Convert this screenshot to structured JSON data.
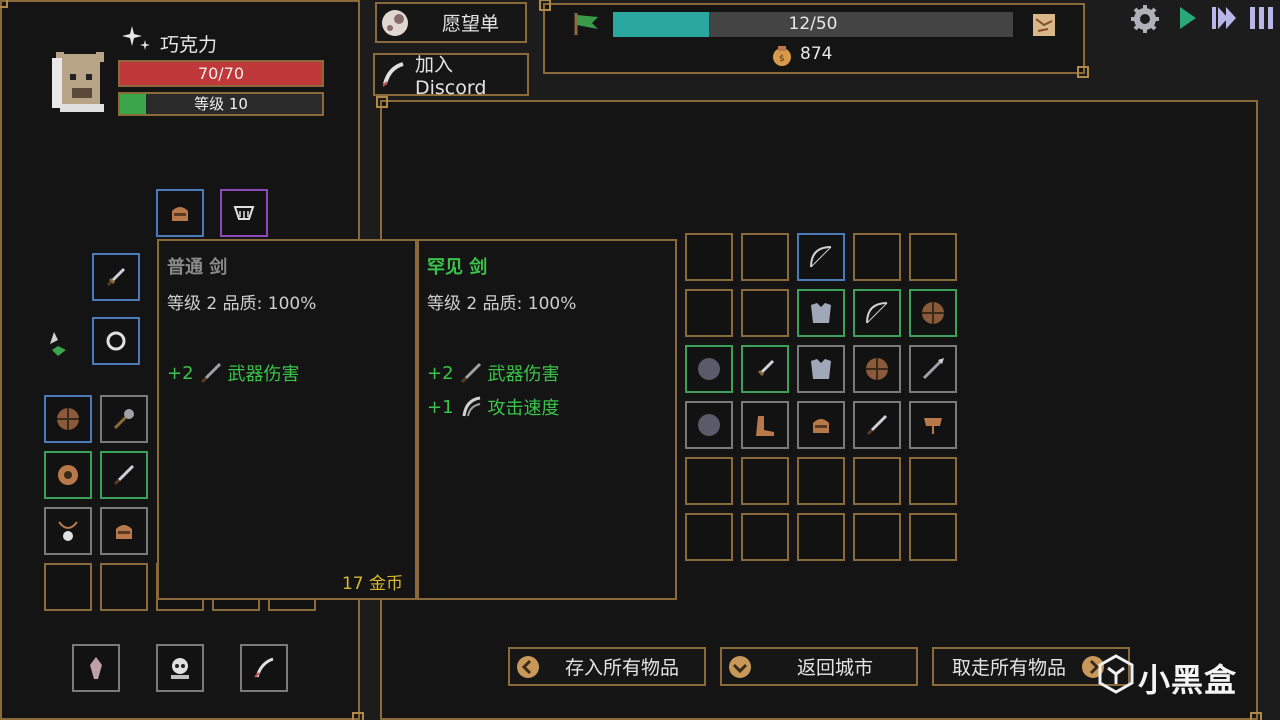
{
  "character": {
    "name": "巧克力",
    "hp_text": "70/70",
    "hp_fraction": 1.0,
    "level_text": "等级 10",
    "xp_fraction": 0.13
  },
  "top": {
    "wishlist_label": "愿望单",
    "discord_label": "加入 Discord",
    "progress_text": "12/50",
    "progress_fraction": 0.24,
    "gold": "874"
  },
  "controls": {
    "settings_icon": "gear-icon",
    "play_icon": "play-icon",
    "fast_icon": "fast-forward-icon",
    "pause_icon": "pause-icon"
  },
  "tooltip_left": {
    "title": "普通 剑",
    "line": "等级 2 品质: 100%",
    "stats": [
      {
        "value": "+2",
        "label": "武器伤害"
      }
    ],
    "price": "17 金币"
  },
  "tooltip_right": {
    "title": "罕见 剑",
    "line": "等级 2 品质: 100%",
    "stats": [
      {
        "value": "+2",
        "label": "武器伤害"
      },
      {
        "value": "+1",
        "label": "攻击速度"
      }
    ]
  },
  "bottom_buttons": {
    "store_all": "存入所有物品",
    "return_city": "返回城市",
    "take_all": "取走所有物品"
  },
  "watermark": "小黑盒",
  "colors": {
    "border": "#8a6a3a",
    "hp": "#c0393a",
    "xp": "#3aa54a",
    "progress": "#2aa8a0",
    "common": "#8a8a8a",
    "rare_title": "#3ac24a",
    "gold_text": "#d8b830"
  }
}
